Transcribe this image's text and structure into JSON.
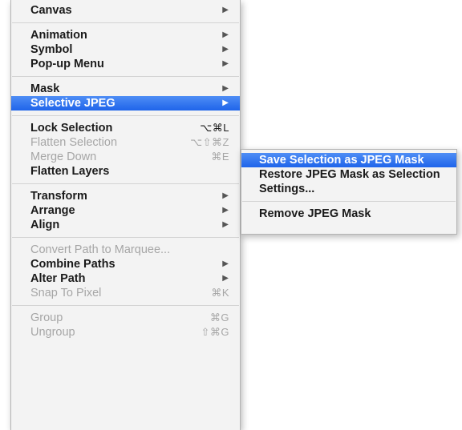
{
  "main_menu": {
    "groups": [
      [
        {
          "label": "Canvas",
          "submenu": true
        }
      ],
      [
        {
          "label": "Animation",
          "submenu": true
        },
        {
          "label": "Symbol",
          "submenu": true
        },
        {
          "label": "Pop-up Menu",
          "submenu": true
        }
      ],
      [
        {
          "label": "Mask",
          "submenu": true
        },
        {
          "label": "Selective JPEG",
          "submenu": true,
          "highlighted": true
        }
      ],
      [
        {
          "label": "Lock Selection",
          "shortcut": "⌥⌘L"
        },
        {
          "label": "Flatten Selection",
          "shortcut": "⌥⇧⌘Z",
          "disabled": true
        },
        {
          "label": "Merge Down",
          "shortcut": "⌘E",
          "disabled": true
        },
        {
          "label": "Flatten Layers"
        }
      ],
      [
        {
          "label": "Transform",
          "submenu": true
        },
        {
          "label": "Arrange",
          "submenu": true
        },
        {
          "label": "Align",
          "submenu": true
        }
      ],
      [
        {
          "label": "Convert Path to Marquee...",
          "disabled": true
        },
        {
          "label": "Combine Paths",
          "submenu": true
        },
        {
          "label": "Alter Path",
          "submenu": true
        },
        {
          "label": "Snap To Pixel",
          "shortcut": "⌘K",
          "disabled": true
        }
      ],
      [
        {
          "label": "Group",
          "shortcut": "⌘G",
          "disabled": true
        },
        {
          "label": "Ungroup",
          "shortcut": "⇧⌘G",
          "disabled": true
        }
      ]
    ],
    "submenu_arrow": "▶"
  },
  "selective_jpeg_submenu": {
    "items": [
      {
        "label": "Save Selection as JPEG Mask",
        "highlighted": true
      },
      {
        "label": "Restore JPEG Mask as Selection"
      },
      {
        "label": "Settings..."
      },
      {
        "separator": true
      },
      {
        "label": "Remove JPEG Mask"
      }
    ]
  },
  "colors": {
    "highlight": "#2f74ef",
    "menu_background": "#f3f3f3",
    "disabled_text": "#a6a6a6"
  }
}
